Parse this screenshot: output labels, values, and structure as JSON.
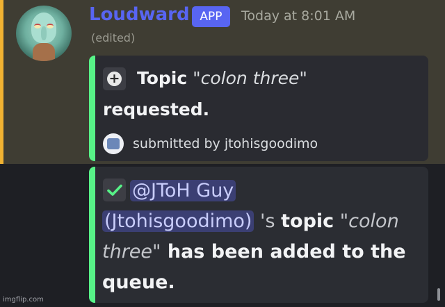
{
  "message": {
    "username": "Loudward",
    "badge": "APP",
    "timestamp": "Today at 8:01 AM",
    "edited_label": "(edited)"
  },
  "embed_request": {
    "icon": "plus-icon",
    "topic_label": "Topic",
    "topic_value": "\"colon three\"",
    "status": "requested.",
    "submitted_text": "submitted by jtohisgoodimo"
  },
  "embed_queue": {
    "icon": "checkmark-icon",
    "mention_line1": "@JToH Guy",
    "mention_line2": "(Jtohisgoodimo)",
    "possessive": " 's ",
    "topic_word": "topic",
    "topic_value": "\"colon three\"",
    "suffix": " has been added to the queue."
  },
  "watermark": "imgflip.com",
  "colors": {
    "accent": "#5865f2",
    "embed_bar": "#57f287",
    "mention_highlight": "#f0b232"
  }
}
